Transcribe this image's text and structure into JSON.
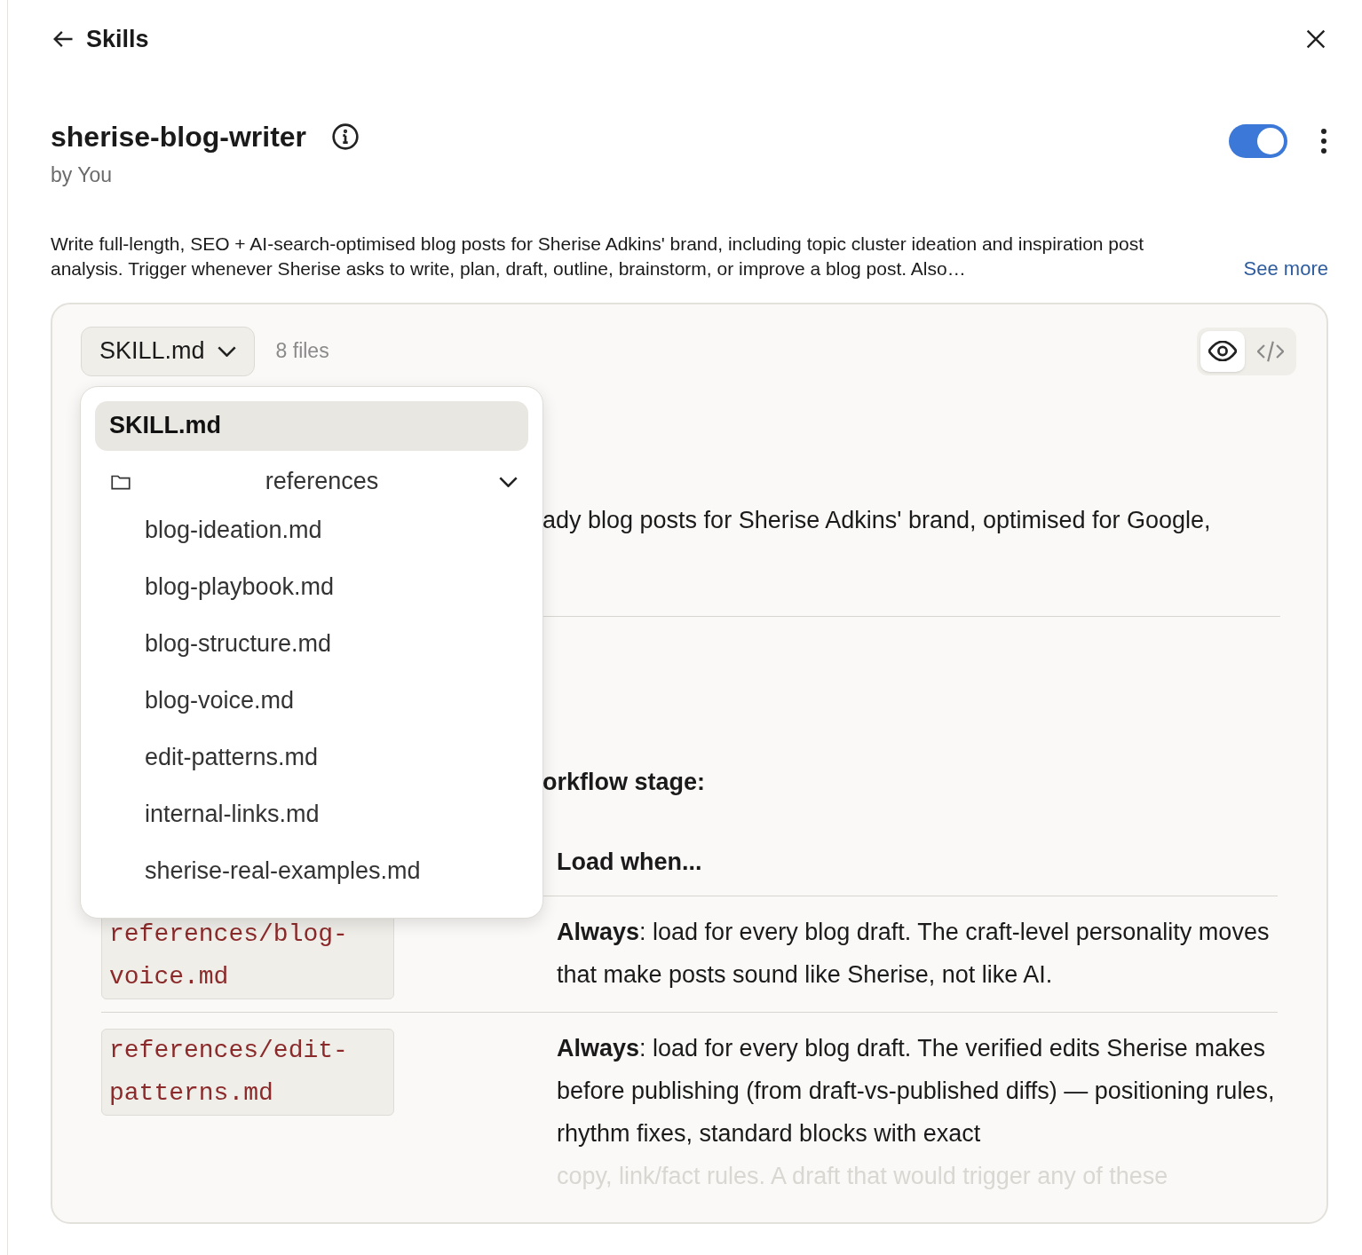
{
  "header": {
    "back_label": "Skills"
  },
  "skill": {
    "name": "sherise-blog-writer",
    "author": "by You",
    "enabled": true,
    "description": "Write full-length, SEO + AI-search-optimised blog posts for Sherise Adkins' brand, including topic cluster ideation and inspiration post analysis. Trigger whenever Sherise asks to write, plan, draft, outline, brainstorm, or improve a blog post. Also…",
    "see_more": "See more"
  },
  "file_picker": {
    "current": "SKILL.md",
    "count": "8 files",
    "open": true
  },
  "view_modes": [
    {
      "kind": "preview",
      "selected": true
    },
    {
      "kind": "code",
      "selected": false
    }
  ],
  "file_menu": {
    "files": [
      {
        "label": "SKILL.md",
        "selected": true
      }
    ],
    "folders": [
      {
        "label": "references",
        "expanded": true,
        "children": [
          {
            "label": "blog-ideation.md",
            "selected": false
          },
          {
            "label": "blog-playbook.md",
            "selected": false
          },
          {
            "label": "blog-structure.md",
            "selected": false
          },
          {
            "label": "blog-voice.md",
            "selected": false
          },
          {
            "label": "edit-patterns.md",
            "selected": false
          },
          {
            "label": "internal-links.md",
            "selected": false
          },
          {
            "label": "sherise-real-examples.md",
            "selected": false
          }
        ]
      }
    ]
  },
  "content": {
    "paragraph_fragment": "ady blog posts for Sherise Adkins' brand, optimised for Google,",
    "heading_fragment": "orkflow stage:",
    "table": {
      "columns": [
        "Load when..."
      ],
      "rows": [
        {
          "file": "references/blog-voice.md",
          "condition": "**Always**: load for every blog draft. The craft-level personality moves that make posts sound like Sherise, not like AI."
        },
        {
          "file": "references/edit-patterns.md",
          "condition": "**Always**: load for every blog draft. The verified edits Sherise makes before publishing (from draft-vs-published diffs) — positioning rules, rhythm fixes, standard blocks with exact",
          "faded_tail": "copy, link/fact rules. A draft that would trigger any of these"
        }
      ]
    }
  }
}
